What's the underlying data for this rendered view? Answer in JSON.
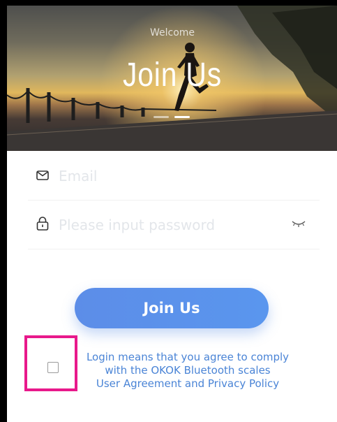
{
  "hero": {
    "welcome": "Welcome",
    "title": "Join Us"
  },
  "form": {
    "email": {
      "placeholder": "Email",
      "value": "",
      "icon": "envelope-icon"
    },
    "password": {
      "placeholder": "Please input password",
      "value": "",
      "icon": "lock-icon",
      "toggle_icon": "eye-closed-icon"
    }
  },
  "join_button": "Join Us",
  "agreement": {
    "checked": false,
    "line1": "Login means that you agree to comply",
    "line2": "with the OKOK Bluetooth scales",
    "line3": "User Agreement and Privacy Policy"
  },
  "colors": {
    "accent": "#5b8fe9",
    "link": "#4a84d6",
    "highlight": "#e8198b"
  }
}
